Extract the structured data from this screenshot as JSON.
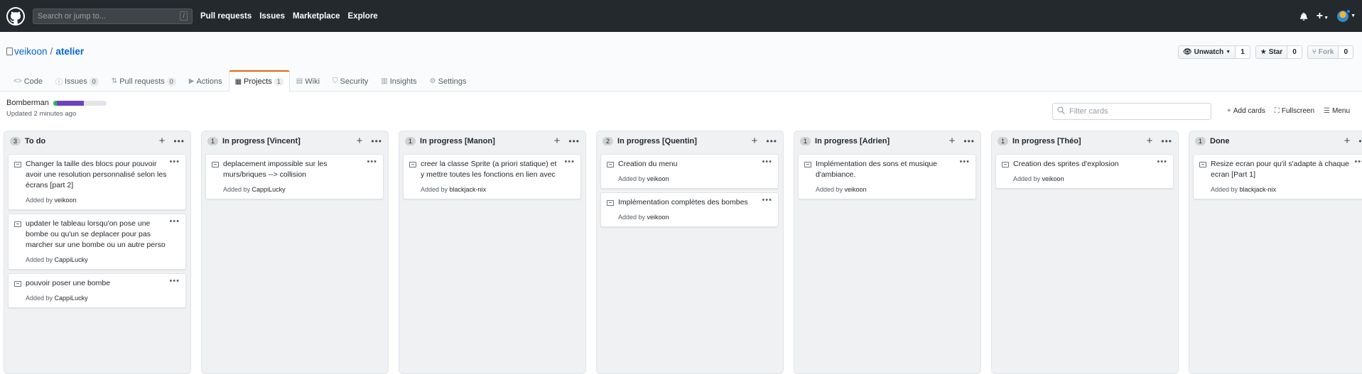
{
  "topbar": {
    "search_placeholder": "Search or jump to...",
    "search_shortcut": "/",
    "nav": [
      "Pull requests",
      "Issues",
      "Marketplace",
      "Explore"
    ]
  },
  "repo": {
    "owner": "veikoon",
    "name": "atelier",
    "watch_label": "Unwatch",
    "watch_count": "1",
    "star_label": "Star",
    "star_count": "0",
    "fork_label": "Fork",
    "fork_count": "0"
  },
  "tabs": [
    {
      "label": "Code",
      "counter": ""
    },
    {
      "label": "Issues",
      "counter": "0"
    },
    {
      "label": "Pull requests",
      "counter": "0"
    },
    {
      "label": "Actions",
      "counter": ""
    },
    {
      "label": "Projects",
      "counter": "1"
    },
    {
      "label": "Wiki",
      "counter": ""
    },
    {
      "label": "Security",
      "counter": ""
    },
    {
      "label": "Insights",
      "counter": ""
    },
    {
      "label": "Settings",
      "counter": ""
    }
  ],
  "project": {
    "name": "Bomberman",
    "updated": "Updated 2 minutes ago",
    "progress_done_pct": 7,
    "progress_inprogress_pct": 50,
    "filter_placeholder": "Filter cards",
    "add_cards": "Add cards",
    "fullscreen": "Fullscreen",
    "menu": "Menu"
  },
  "columns": [
    {
      "title": "To do",
      "count": "3",
      "cards": [
        {
          "text": "Changer la taille des blocs pour pouvoir avoir une resolution personnalisé selon les écrans [part 2]",
          "added_by": "veikoon"
        },
        {
          "text": "updater le tableau lorsqu'on pose une bombe ou qu'un se deplacer pour pas marcher sur une bombe ou un autre perso",
          "added_by": "CappiLucky"
        },
        {
          "text": "pouvoir poser une bombe",
          "added_by": "CappiLucky"
        }
      ]
    },
    {
      "title": "In progress [Vincent]",
      "count": "1",
      "cards": [
        {
          "text": "deplacement impossible sur les murs/briques --> collision",
          "added_by": "CappiLucky"
        }
      ]
    },
    {
      "title": "In progress [Manon]",
      "count": "1",
      "cards": [
        {
          "text": "creer la classe Sprite (a priori statique) et y mettre toutes les fonctions en lien avec",
          "added_by": "blackjack-nix"
        }
      ]
    },
    {
      "title": "In progress [Quentin]",
      "count": "2",
      "cards": [
        {
          "text": "Creation du menu",
          "added_by": "veikoon"
        },
        {
          "text": "Implémentation complètes des bombes",
          "added_by": "veikoon"
        }
      ]
    },
    {
      "title": "In progress [Adrien]",
      "count": "1",
      "cards": [
        {
          "text": "Implémentation des sons et musique d'ambiance.",
          "added_by": "veikoon"
        }
      ]
    },
    {
      "title": "In progress [Théo]",
      "count": "1",
      "cards": [
        {
          "text": "Creation des sprites d'explosion",
          "added_by": "veikoon"
        }
      ]
    },
    {
      "title": "Done",
      "count": "1",
      "cards": [
        {
          "text": "Resize ecran pour qu'il s'adapte à chaque ecran [Part 1]",
          "added_by": "blackjack-nix"
        }
      ]
    }
  ],
  "labels": {
    "added_by_prefix": "Added by"
  }
}
